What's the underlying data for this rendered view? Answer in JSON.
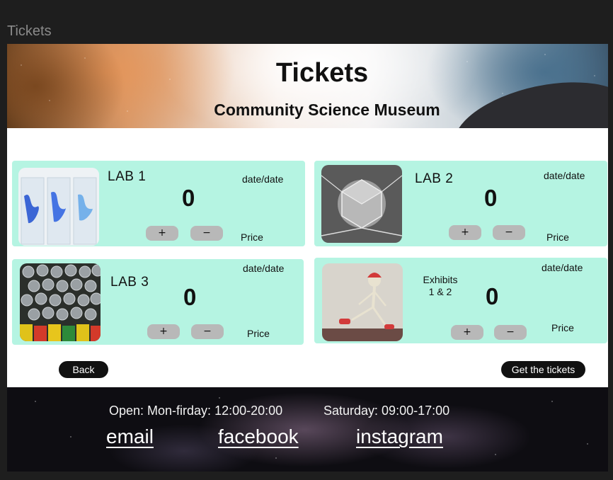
{
  "frame": {
    "label": "Tickets"
  },
  "hero": {
    "title": "Tickets",
    "subtitle": "Community Science Museum"
  },
  "cards": [
    {
      "title": "LAB 1",
      "date": "date/date",
      "count": "0",
      "plus": "+",
      "minus": "−",
      "price": "Price",
      "image": "blue-ink-glasses-photo"
    },
    {
      "title": "LAB 2",
      "date": "date/date",
      "count": "0",
      "plus": "+",
      "minus": "−",
      "price": "Price",
      "image": "geometric-sphere-photo"
    },
    {
      "title": "LAB 3",
      "date": "date/date",
      "count": "0",
      "plus": "+",
      "minus": "−",
      "price": "Price",
      "image": "batteries-photo"
    },
    {
      "title": "Exhibits\n1 & 2",
      "date": "date/date",
      "count": "0",
      "plus": "+",
      "minus": "−",
      "price": "Price",
      "image": "skeleton-figure-photo"
    }
  ],
  "actions": {
    "back": "Back",
    "get_tickets": "Get the tickets"
  },
  "footer": {
    "hours_weekdays": "Open: Mon-firday: 12:00-20:00",
    "hours_saturday": "Saturday: 09:00-17:00",
    "links": [
      "email",
      "facebook",
      "instagram"
    ]
  },
  "colors": {
    "card_bg": "#b5f4e2",
    "button_dark": "#111111",
    "qty_button": "#b8b8b8"
  }
}
